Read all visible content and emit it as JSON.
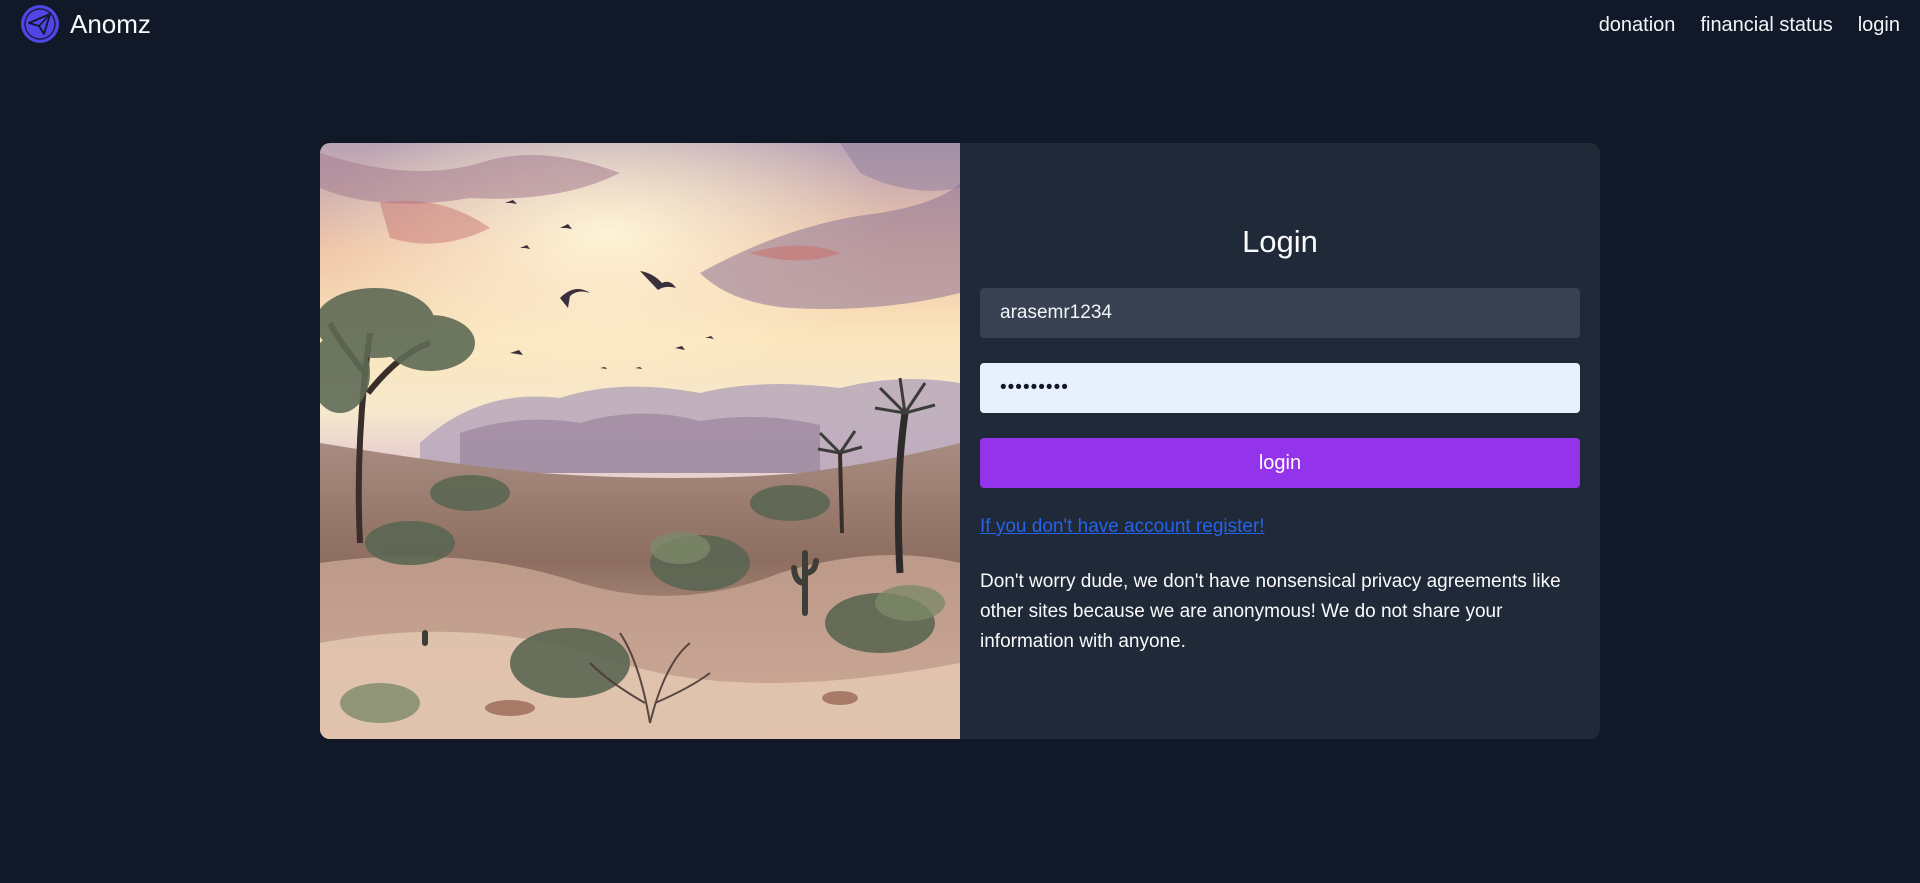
{
  "app": {
    "name": "Anomz",
    "logo_icon": "paper-plane-icon"
  },
  "nav": {
    "items": [
      {
        "label": "donation"
      },
      {
        "label": "financial status"
      },
      {
        "label": "login"
      }
    ]
  },
  "login_form": {
    "title": "Login",
    "username_value": "arasemr1234",
    "password_value": "•••••••••",
    "submit_label": "login",
    "register_link": "If you don't have account register!",
    "privacy_note": "Don't worry dude, we don't have nonsensical privacy agreements like other sites because we are anonymous! We do not share your information with anyone."
  },
  "hero_image": {
    "subject": "watercolor desert landscape with flying birds at sunset"
  },
  "colors": {
    "background": "#111827",
    "card": "#1f2937",
    "input_dark": "#374151",
    "input_autofill": "#e8f0fe",
    "accent": "#9333ea",
    "link": "#2563eb",
    "logo": "#4f46e5"
  }
}
